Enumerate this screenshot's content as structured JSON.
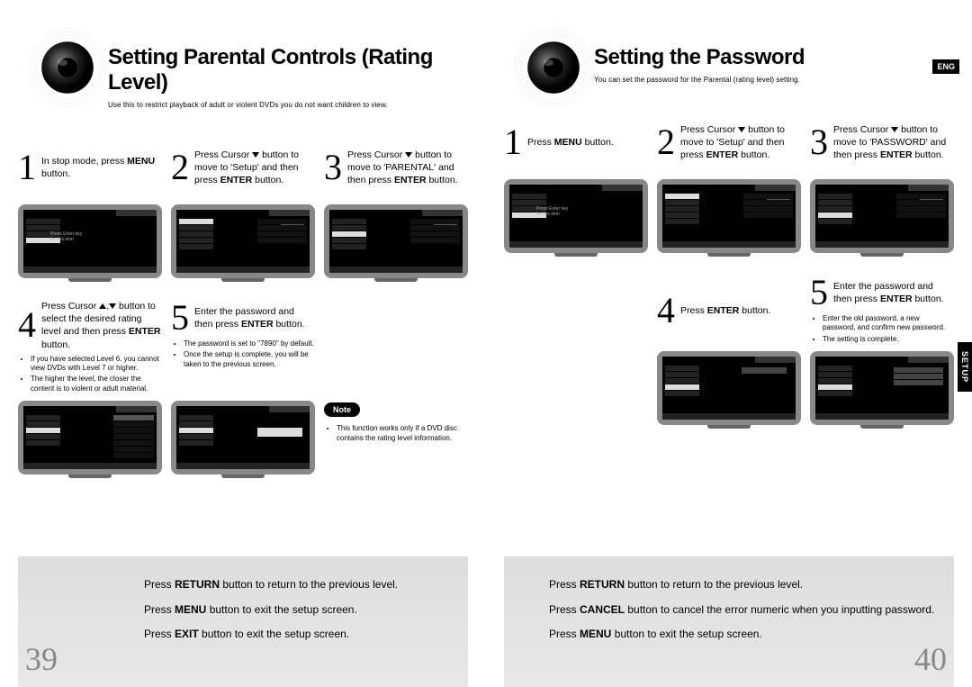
{
  "left": {
    "title": "Setting Parental Controls (Rating Level)",
    "sub": "Use this to restrict playback of adult or violent DVDs you do not want children to view.",
    "step1_a": "In stop mode, press",
    "step1_b": "MENU",
    "step1_c": " button.",
    "step2_a": "Press Cursor ",
    "step2_b": " button to move to 'Setup' and then press ",
    "step2_c": "ENTER",
    "step2_d": " button.",
    "step3_a": "Press Cursor ",
    "step3_b": " button to move to 'PARENTAL' and then press ",
    "step3_c": "ENTER",
    "step3_d": " button.",
    "step4_a": "Press Cursor ",
    "step4_b": " button to select the desired rating level and then press ",
    "step4_c": "ENTER",
    "step4_d": " button.",
    "step4_bul1": "If you have selected Level 6, you cannot view DVDs with Level 7 or higher.",
    "step4_bul2": "The higher the level, the closer the content is to violent or adult material.",
    "step5_a": "Enter the password and then press ",
    "step5_b": "ENTER",
    "step5_c": " button.",
    "step5_bul1": "The password is set to \"7890\" by default.",
    "step5_bul2": "Once the setup is complete, you will be taken to the previous screen.",
    "note_label": "Note",
    "note_bul1": "This function works only if a DVD disc contains the rating level information.",
    "footer1_a": "Press ",
    "footer1_b": "RETURN",
    "footer1_c": " button to return to the previous level.",
    "footer2_a": "Press ",
    "footer2_b": "MENU",
    "footer2_c": " button to exit the setup screen.",
    "footer3_a": "Press ",
    "footer3_b": "EXIT",
    "footer3_c": " button to exit the setup screen.",
    "pageno": "39"
  },
  "right": {
    "title": "Setting the Password",
    "sub": "You can set the password for the Parental (rating level) setting.",
    "lang": "ENG",
    "tab": "SETUP",
    "step1_a": "Press ",
    "step1_b": "MENU",
    "step1_c": " button.",
    "step2_a": "Press Cursor ",
    "step2_b": " button to move to 'Setup' and then press ",
    "step2_c": "ENTER",
    "step2_d": " button.",
    "step3_a": "Press Cursor ",
    "step3_b": " button to move to 'PASSWORD' and then press ",
    "step3_c": "ENTER",
    "step3_d": " button.",
    "step4_a": "Press ",
    "step4_b": "ENTER",
    "step4_c": " button.",
    "step5_a": "Enter the password and then press ",
    "step5_b": "ENTER",
    "step5_c": " button.",
    "step5_bul1": "Enter the old password, a new password, and confirm new password.",
    "step5_bul2": "The setting is complete.",
    "footer1_a": "Press ",
    "footer1_b": "RETURN",
    "footer1_c": " button to return to the previous level.",
    "footer2_a": "Press ",
    "footer2_b": "CANCEL",
    "footer2_c": " button to cancel the error numeric when you inputting password.",
    "footer3_a": "Press ",
    "footer3_b": "MENU",
    "footer3_c": " button to exit the setup screen.",
    "pageno": "40"
  },
  "nums": {
    "n1": "1",
    "n2": "2",
    "n3": "3",
    "n4": "4",
    "n5": "5"
  }
}
